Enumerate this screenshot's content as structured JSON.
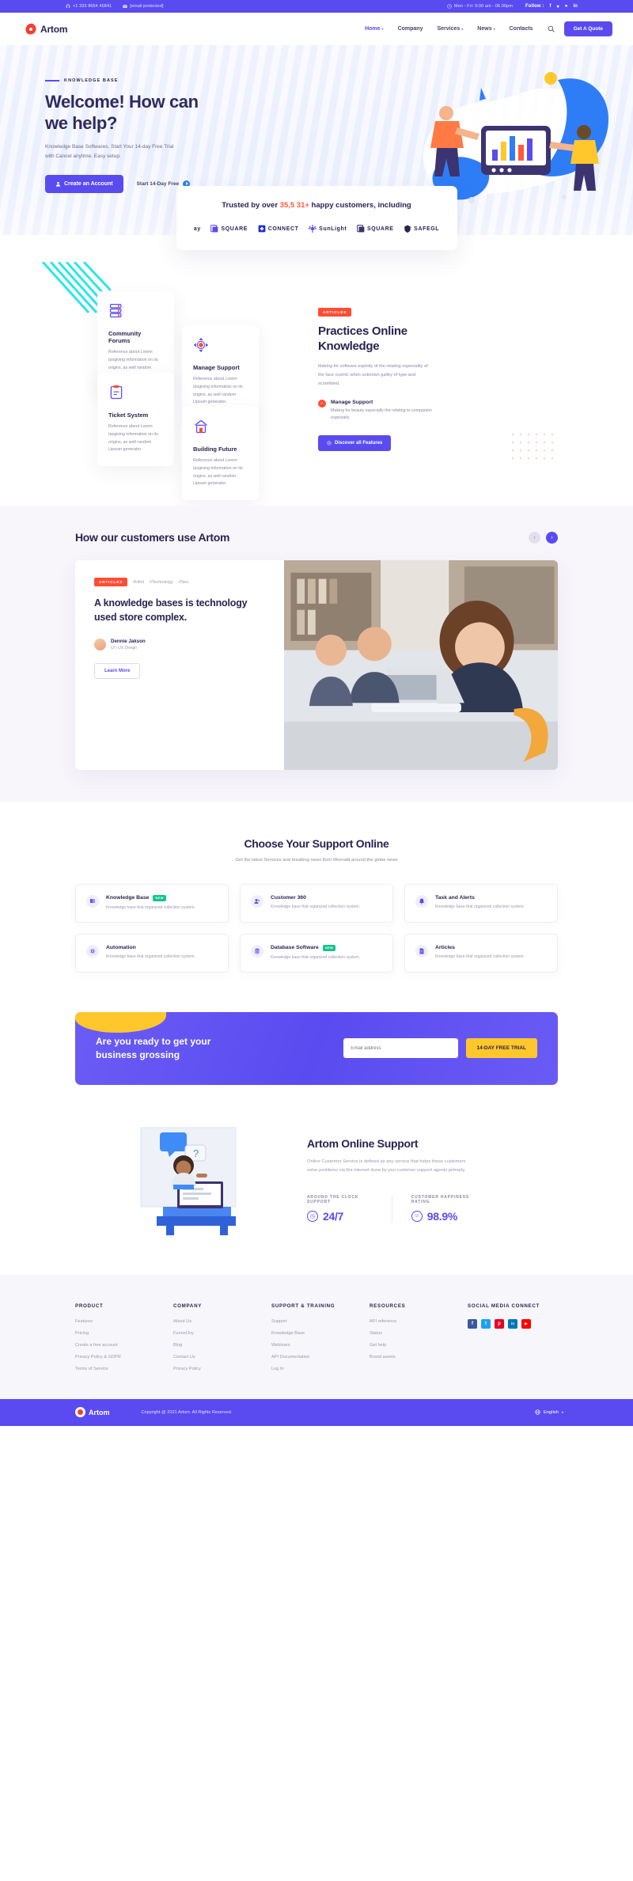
{
  "topbar": {
    "phone": "+1 333 8654 45841",
    "email": "[email protected]",
    "hours": "Mon - Fri: 9:00 am - 06.00pm",
    "follow_label": "Follow :",
    "socials": [
      "facebook-icon",
      "twitter-icon",
      "behance-icon",
      "linkedin-icon"
    ]
  },
  "nav": {
    "brand": "Artom",
    "items": [
      {
        "label": "Home",
        "has_caret": true,
        "active": true
      },
      {
        "label": "Company",
        "has_caret": false,
        "active": false
      },
      {
        "label": "Services",
        "has_caret": true,
        "active": false
      },
      {
        "label": "News",
        "has_caret": true,
        "active": false
      },
      {
        "label": "Contacts",
        "has_caret": false,
        "active": false
      }
    ],
    "quote_button": "Get A Quote"
  },
  "hero": {
    "eyebrow": "KNOWLEDGE BASE",
    "title": "Welcome! How can we help?",
    "paragraph": "Knowledge Base Softwares. Start Your 14-day Free Trial with Cancel anytime. Easy setup.",
    "primary_button": "Create an Account",
    "secondary_link": "Start 14-Day Free"
  },
  "trust": {
    "title_prefix": "Trusted by over ",
    "highlight": "35,5 31+",
    "title_suffix": " happy customers, including",
    "logos": [
      "ay",
      "SQUARE",
      "CONNECT",
      "SunLight",
      "SQUARE",
      "SAFEGL"
    ]
  },
  "features": {
    "cards": [
      {
        "title": "Community Forums",
        "text": "Reference about Lorem Ipsgiving information on its origins, as well random Lipsum generator.",
        "icon": "server-stack-icon"
      },
      {
        "title": "Manage Support",
        "text": "Reference about Lorem Ipsgiving information on its origins, as well random Lipsum generator.",
        "icon": "move-arrows-icon"
      },
      {
        "title": "Ticket System",
        "text": "Reference about Lorem Ipsgiving information on its origins, as well random Lipsum generator.",
        "icon": "ticket-icon"
      },
      {
        "title": "Building Future",
        "text": "Reference about Lorem Ipsgiving information on its origins, as well random Lipsum generator.",
        "icon": "building-icon"
      }
    ],
    "badge": "ARTICLES",
    "heading": "Practices Online Knowledge",
    "paragraph": "Making for software esploity of the relating especiality of the face cosmic when unknown galley of type and scrambled.",
    "sub_title": "Manage Support",
    "sub_text": "Making for beauty especially the relating to companion especially.",
    "discover_button": "Discover all Features"
  },
  "customers": {
    "heading": "How our customers use Artom",
    "prev": "‹",
    "next": "›",
    "card": {
      "badge": "ARTICLES",
      "tags": [
        "#Html",
        "#Technology",
        "#Seo"
      ],
      "title": "A knowledge bases is technology used store complex.",
      "author_name": "Dennie Jakson",
      "author_role": "UI \\ UX Design",
      "button": "Learn More"
    }
  },
  "support": {
    "heading": "Choose Your Support Online",
    "subtitle": "Get the latest Services and breaking news from Wonrald around the globe news",
    "cards": [
      {
        "title": "Knowledge Base",
        "badge": "NEW",
        "text": "Knowledge base that organized collection system.",
        "icon": "book-icon"
      },
      {
        "title": "Customer 360",
        "badge": "",
        "text": "Knowledge base that organized collection system.",
        "icon": "users-icon"
      },
      {
        "title": "Task and Alerts",
        "badge": "",
        "text": "Knowledge base that organized collection system.",
        "icon": "bell-icon"
      },
      {
        "title": "Automation",
        "badge": "",
        "text": "Knowledge base that organized collection system.",
        "icon": "gear-icon"
      },
      {
        "title": "Database Software",
        "badge": "NEW",
        "text": "Knowledge base that organized collection system.",
        "icon": "database-icon"
      },
      {
        "title": "Articles",
        "badge": "",
        "text": "Knowledge base that organized collection system.",
        "icon": "document-icon"
      }
    ]
  },
  "cta": {
    "heading": "Are you ready to get your business grossing",
    "input_placeholder": "Email address",
    "button": "14-DAY FREE TRIAL"
  },
  "online_support": {
    "heading": "Artom Online Support",
    "paragraph": "Online Customer Service is defined as any service that helps these customers solve problems via the internet done by you customer support agents primarly.",
    "stats": [
      {
        "label": "AROUND THE CLOCK SUPPORT",
        "value": "24/7",
        "icon": "clock-icon"
      },
      {
        "label": "CUSTOMER HAPPINESS RATING",
        "value": "98.9%",
        "icon": "smile-icon"
      }
    ]
  },
  "footer": {
    "columns": [
      {
        "heading": "PRODUCT",
        "links": [
          "Features",
          "Pricing",
          "Create a free account",
          "Privacy Policy & GDPR",
          "Terms of Service"
        ]
      },
      {
        "heading": "COMPANY",
        "links": [
          "About Us",
          "FunnelJoy",
          "Blog",
          "Contact Us",
          "Privacy Policy"
        ]
      },
      {
        "heading": "SUPPORT & TRAINING",
        "links": [
          "Support",
          "Knowledge Base",
          "Webinars",
          "API Documentation",
          "Log In"
        ]
      },
      {
        "heading": "RESOURCES",
        "links": [
          "API reference",
          "Status",
          "Get help",
          "Brand assets"
        ]
      }
    ],
    "social_heading": "SOCIAL MEDIA CONNECT",
    "socials": [
      {
        "name": "facebook-icon",
        "glyph": "f",
        "color": "#3b5998"
      },
      {
        "name": "twitter-icon",
        "glyph": "t",
        "color": "#1da1f2"
      },
      {
        "name": "pinterest-icon",
        "glyph": "p",
        "color": "#e60023"
      },
      {
        "name": "linkedin-icon",
        "glyph": "in",
        "color": "#0077b5"
      },
      {
        "name": "youtube-icon",
        "glyph": "▶",
        "color": "#ff0000"
      }
    ]
  },
  "bottombar": {
    "brand": "Artom",
    "copyright": "Copyright @ 2021 Artom. All Rights Reserved.",
    "language": "English"
  },
  "colors": {
    "primary": "#5a4bf0",
    "accent_red": "#ff4d34",
    "accent_yellow": "#ffc72c",
    "dark": "#2b2350",
    "muted": "#9b98b2"
  }
}
